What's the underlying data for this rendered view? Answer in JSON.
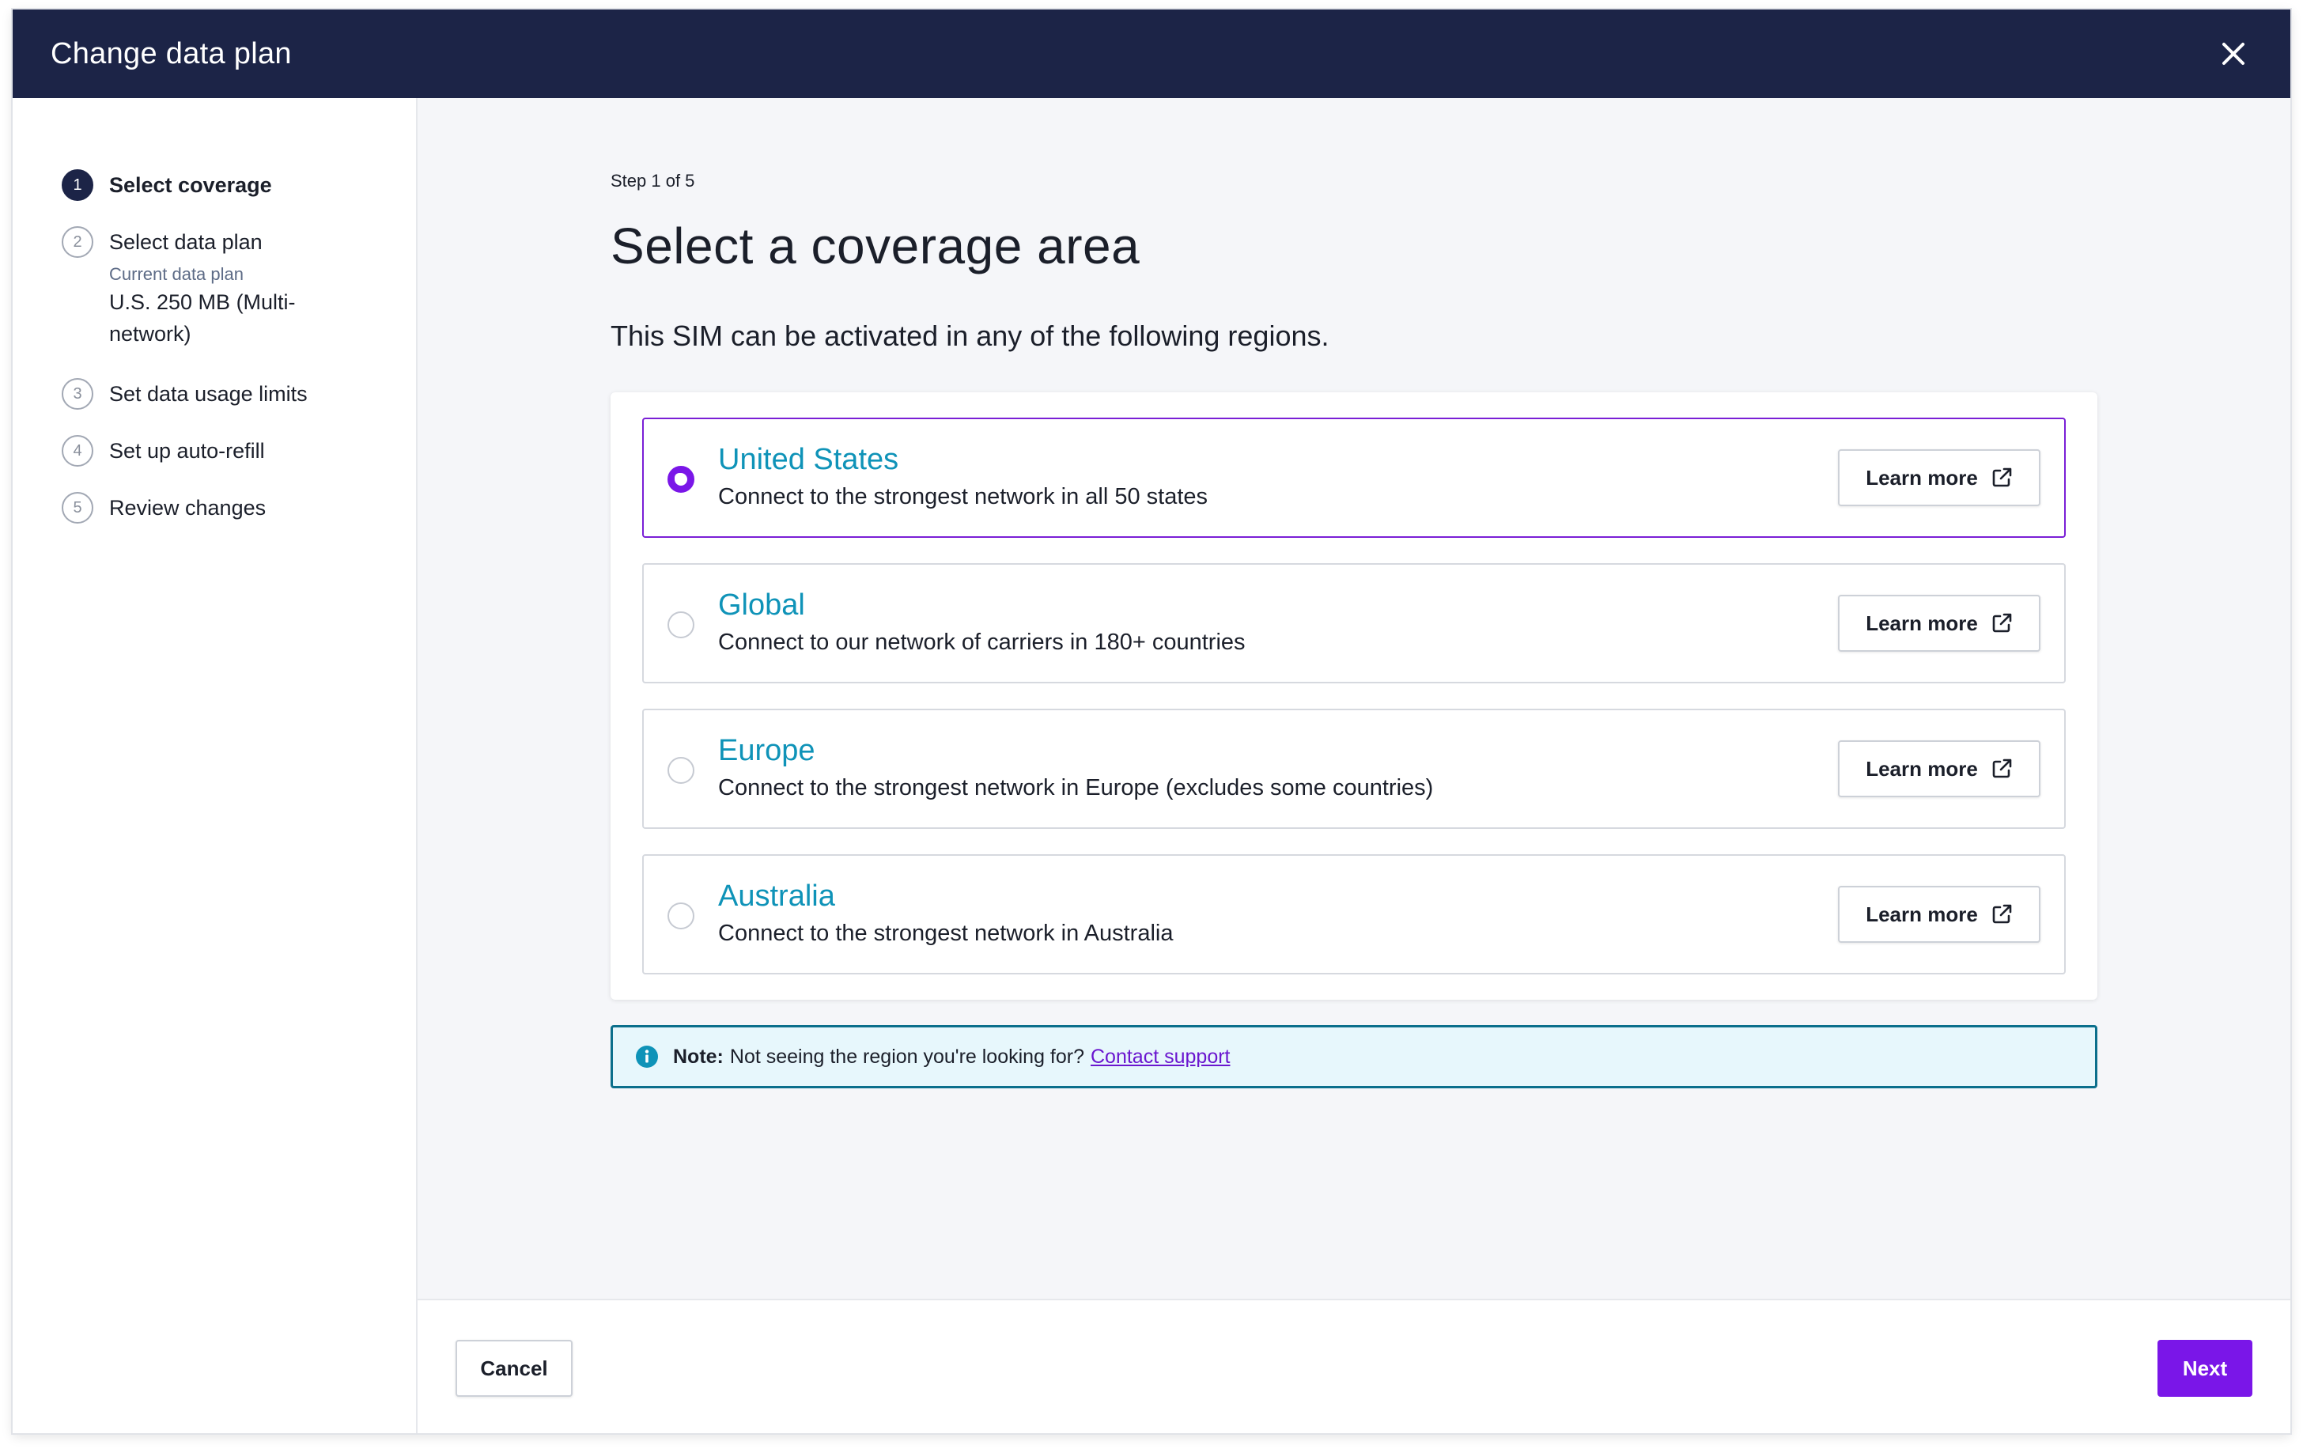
{
  "header": {
    "title": "Change data plan",
    "close_icon": "close-icon"
  },
  "sidebar": {
    "steps": [
      {
        "number": "1",
        "label": "Select coverage",
        "active": true
      },
      {
        "number": "2",
        "label": "Select data plan",
        "sub_label": "Current data plan",
        "sub_value": "U.S. 250 MB (Multi-network)"
      },
      {
        "number": "3",
        "label": "Set data usage limits"
      },
      {
        "number": "4",
        "label": "Set up auto-refill"
      },
      {
        "number": "5",
        "label": "Review changes"
      }
    ]
  },
  "main": {
    "step_indicator": "Step 1 of 5",
    "title": "Select a coverage area",
    "subtitle": "This SIM can be activated in any of the following regions.",
    "options": [
      {
        "title": "United States",
        "description": "Connect to the strongest network in all 50 states",
        "selected": true,
        "button_label": "Learn more"
      },
      {
        "title": "Global",
        "description": "Connect to our network of carriers in 180+ countries",
        "selected": false,
        "button_label": "Learn more"
      },
      {
        "title": "Europe",
        "description": "Connect to the strongest network in Europe (excludes some countries)",
        "selected": false,
        "button_label": "Learn more"
      },
      {
        "title": "Australia",
        "description": "Connect to the strongest network in Australia",
        "selected": false,
        "button_label": "Learn more"
      }
    ],
    "note": {
      "label": "Note:",
      "text": "Not seeing the region you're looking for?",
      "link": "Contact support"
    }
  },
  "footer": {
    "cancel_label": "Cancel",
    "next_label": "Next"
  },
  "colors": {
    "header_bg": "#1c2447",
    "accent_purple": "#7a16e8",
    "option_title_teal": "#0f93b8",
    "note_border": "#0b6f8c",
    "note_bg": "#e7f7fc"
  }
}
